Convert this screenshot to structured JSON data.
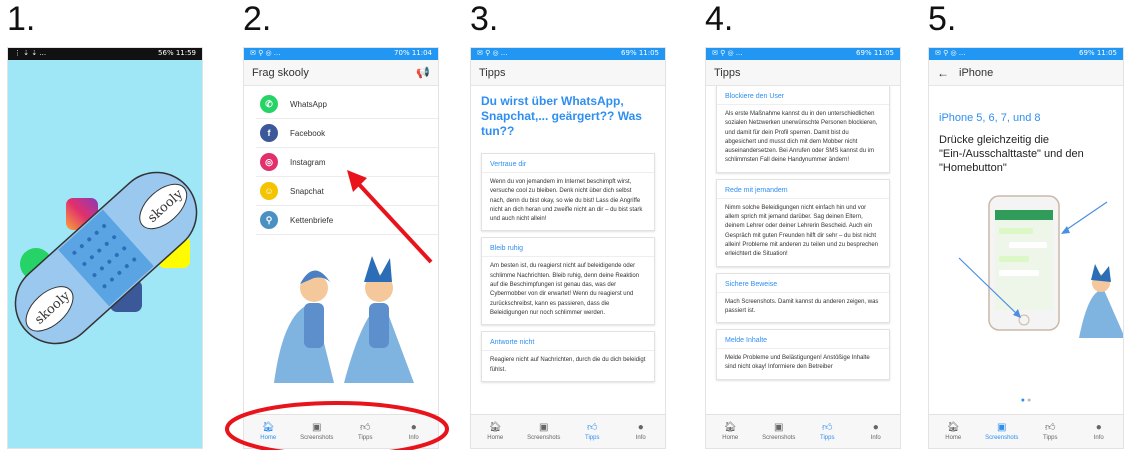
{
  "steps": [
    "1.",
    "2.",
    "3.",
    "4.",
    "5."
  ],
  "colors": {
    "accent": "#2f8ff0",
    "appbar_status": "#2196f3",
    "annotation": "#e8131b"
  },
  "phone1": {
    "status_right": "56% 11:59",
    "bandage_text": [
      "skooly",
      "skooly",
      "skooly"
    ]
  },
  "phone2": {
    "status_right": "70% 11:04",
    "title": "Frag skooly",
    "menu": [
      {
        "label": "WhatsApp",
        "color": "#25d366",
        "icon": "whatsapp-icon"
      },
      {
        "label": "Facebook",
        "color": "#3b5998",
        "icon": "facebook-icon"
      },
      {
        "label": "Instagram",
        "color": "#e1306c",
        "icon": "instagram-icon"
      },
      {
        "label": "Snapchat",
        "color": "#fffc00",
        "icon": "snapchat-icon"
      },
      {
        "label": "Kettenbriefe",
        "color": "#4a90c2",
        "icon": "chain-icon"
      }
    ]
  },
  "phone3": {
    "status_right": "69% 11:05",
    "title": "Tipps",
    "headline": "Du wirst über WhatsApp, Snapchat,... geärgert?? Was tun??",
    "cards": [
      {
        "title": "Vertraue dir",
        "body": "Wenn du von jemandem im Internet beschimpft wirst, versuche cool zu bleiben. Denk nicht über dich selbst nach, denn du bist okay, so wie du bist! Lass die Angriffe nicht an dich heran und zweifle nicht an dir – du bist stark und auch nicht allein!"
      },
      {
        "title": "Bleib ruhig",
        "body": "Am besten ist, du reagierst nicht auf beleidigende oder schlimme Nachrichten. Bleib ruhig, denn deine Reaktion auf die Beschimpfungen ist genau das, was der Cybermobber von dir erwartet! Wenn du reagierst und zurückschreibst, kann es passieren, dass die Beleidigungen nur noch schlimmer werden."
      },
      {
        "title": "Antworte nicht",
        "body": "Reagiere nicht auf Nachrichten, durch die du dich beleidigt fühlst."
      }
    ]
  },
  "phone4": {
    "status_right": "69% 11:05",
    "title": "Tipps",
    "cards": [
      {
        "title": "Blockiere den User",
        "body": "Als erste Maßnahme kannst du in den unterschiedlichen sozialen Netzwerken unerwünschte Personen blockieren, und damit für dein Profil sperren. Damit bist du abgesichert und musst dich mit dem Mobber nicht auseinandersetzen. Bei Anrufen oder SMS kannst du im schlimmsten Fall deine Handynummer ändern!"
      },
      {
        "title": "Rede mit jemandem",
        "body": "Nimm solche Beleidigungen nicht einfach hin und vor allem sprich mit jemand darüber. Sag deinen Eltern, deinem Lehrer oder deiner Lehrerin Bescheid. Auch ein Gespräch mit guten Freunden hilft dir sehr – du bist nicht allein! Probleme mit anderen zu teilen und zu besprechen erleichtert die Situation!"
      },
      {
        "title": "Sichere Beweise",
        "body": "Mach Screenshots. Damit kannst du anderen zeigen, was passiert ist."
      },
      {
        "title": "Melde Inhalte",
        "body": "Melde Probleme und Belästigungen! Anstößige Inhalte sind nicht okay! Informiere den Betreiber"
      }
    ]
  },
  "phone5": {
    "status_right": "69% 11:05",
    "title": "iPhone",
    "subtitle": "iPhone 5, 6, 7, und 8",
    "text": "Drücke gleichzeitig die \"Ein-/Ausschalttaste\" und den \"Homebutton\""
  },
  "nav": [
    "Home",
    "Screenshots",
    "Tipps",
    "Info"
  ]
}
